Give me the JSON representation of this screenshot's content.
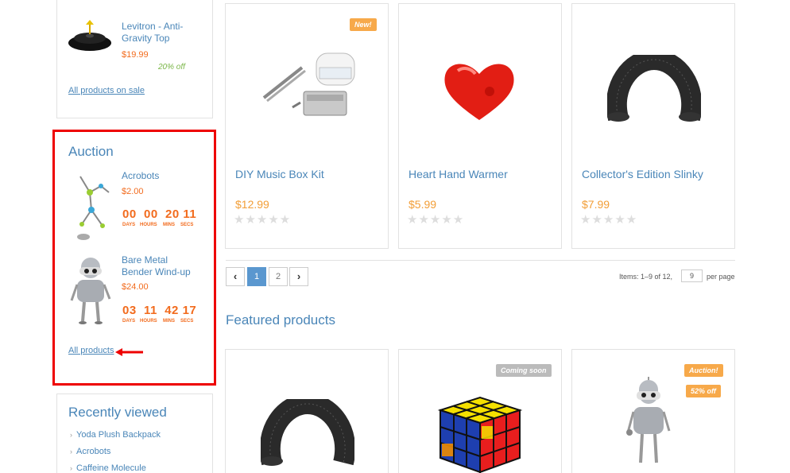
{
  "sale": {
    "item_title": "Levitron - Anti-Gravity Top",
    "item_price": "$19.99",
    "item_off": "20% off",
    "link": "All products on sale"
  },
  "auction": {
    "heading": "Auction",
    "items": [
      {
        "title": "Acrobots",
        "price": "$2.00",
        "timer": "00  00  20 11"
      },
      {
        "title": "Bare Metal Bender Wind-up",
        "price": "$24.00",
        "timer": "03  11  42 17"
      }
    ],
    "timer_labels": [
      "DAYS",
      "HOURS",
      "MINS",
      "SECS"
    ],
    "link": "All products"
  },
  "recent": {
    "heading": "Recently viewed",
    "items": [
      "Yoda Plush Backpack",
      "Acrobots",
      "Caffeine Molecule"
    ]
  },
  "products": [
    {
      "name": "DIY Music Box Kit",
      "price": "$12.99",
      "badge": "New!"
    },
    {
      "name": "Heart Hand Warmer",
      "price": "$5.99"
    },
    {
      "name": "Collector's Edition Slinky",
      "price": "$7.99"
    }
  ],
  "stars": "★★★★★",
  "pagination": {
    "pages": [
      "1",
      "2"
    ],
    "items_text": "Items: 1–9 of 12,",
    "per_value": "9",
    "per_label": "per page"
  },
  "featured": {
    "heading": "Featured products",
    "badges": {
      "coming_soon": "Coming soon",
      "auction": "Auction!",
      "off": "52% off"
    }
  },
  "colors": {
    "accent": "#4a86b8",
    "orange": "#f26b1d",
    "price": "#f29e37",
    "badge": "#f7a94a",
    "highlight": "#ee0000"
  }
}
